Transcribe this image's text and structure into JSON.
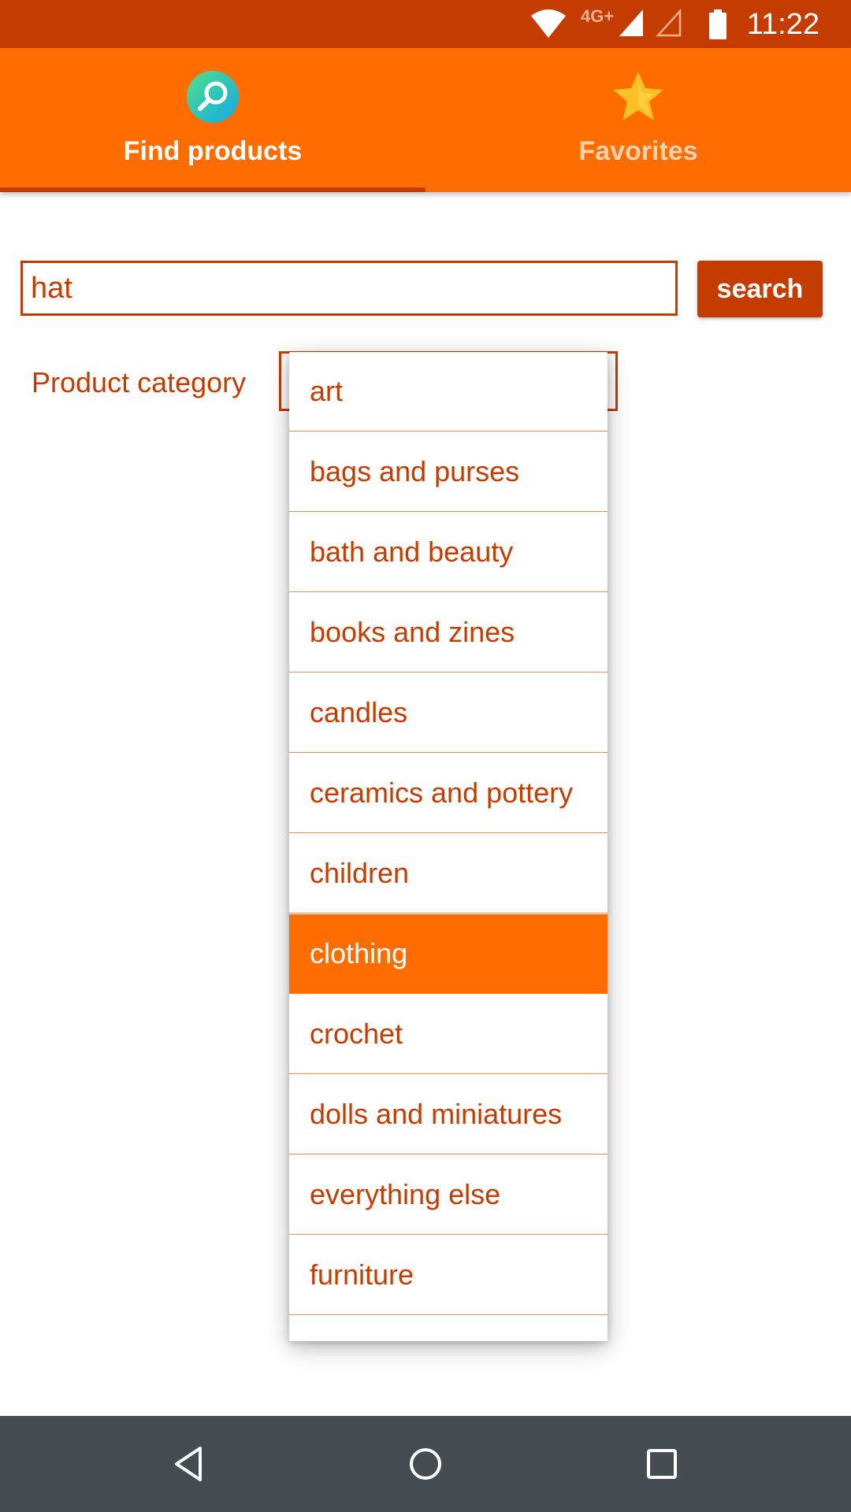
{
  "status_bar": {
    "network_label": "4G+",
    "time": "11:22",
    "icons": [
      "wifi-icon",
      "cell-signal-icon",
      "cell-signal-empty-icon",
      "battery-icon"
    ]
  },
  "tabs": [
    {
      "label": "Find products",
      "icon": "search-icon",
      "active": true
    },
    {
      "label": "Favorites",
      "icon": "star-icon",
      "active": false
    }
  ],
  "search": {
    "value": "hat",
    "button_label": "search"
  },
  "category": {
    "label": "Product category",
    "options": [
      "art",
      "bags and purses",
      "bath and beauty",
      "books and zines",
      "candles",
      "ceramics and pottery",
      "children",
      "clothing",
      "crochet",
      "dolls and miniatures",
      "everything else",
      "furniture"
    ],
    "highlighted": "clothing"
  },
  "nav_bar": {
    "buttons": [
      "back-icon",
      "home-icon",
      "recents-icon"
    ]
  },
  "colors": {
    "status_bar": "#c43c00",
    "primary": "#ff6d00",
    "accent_dark": "#c43c00",
    "nav_bar": "#454c52"
  }
}
